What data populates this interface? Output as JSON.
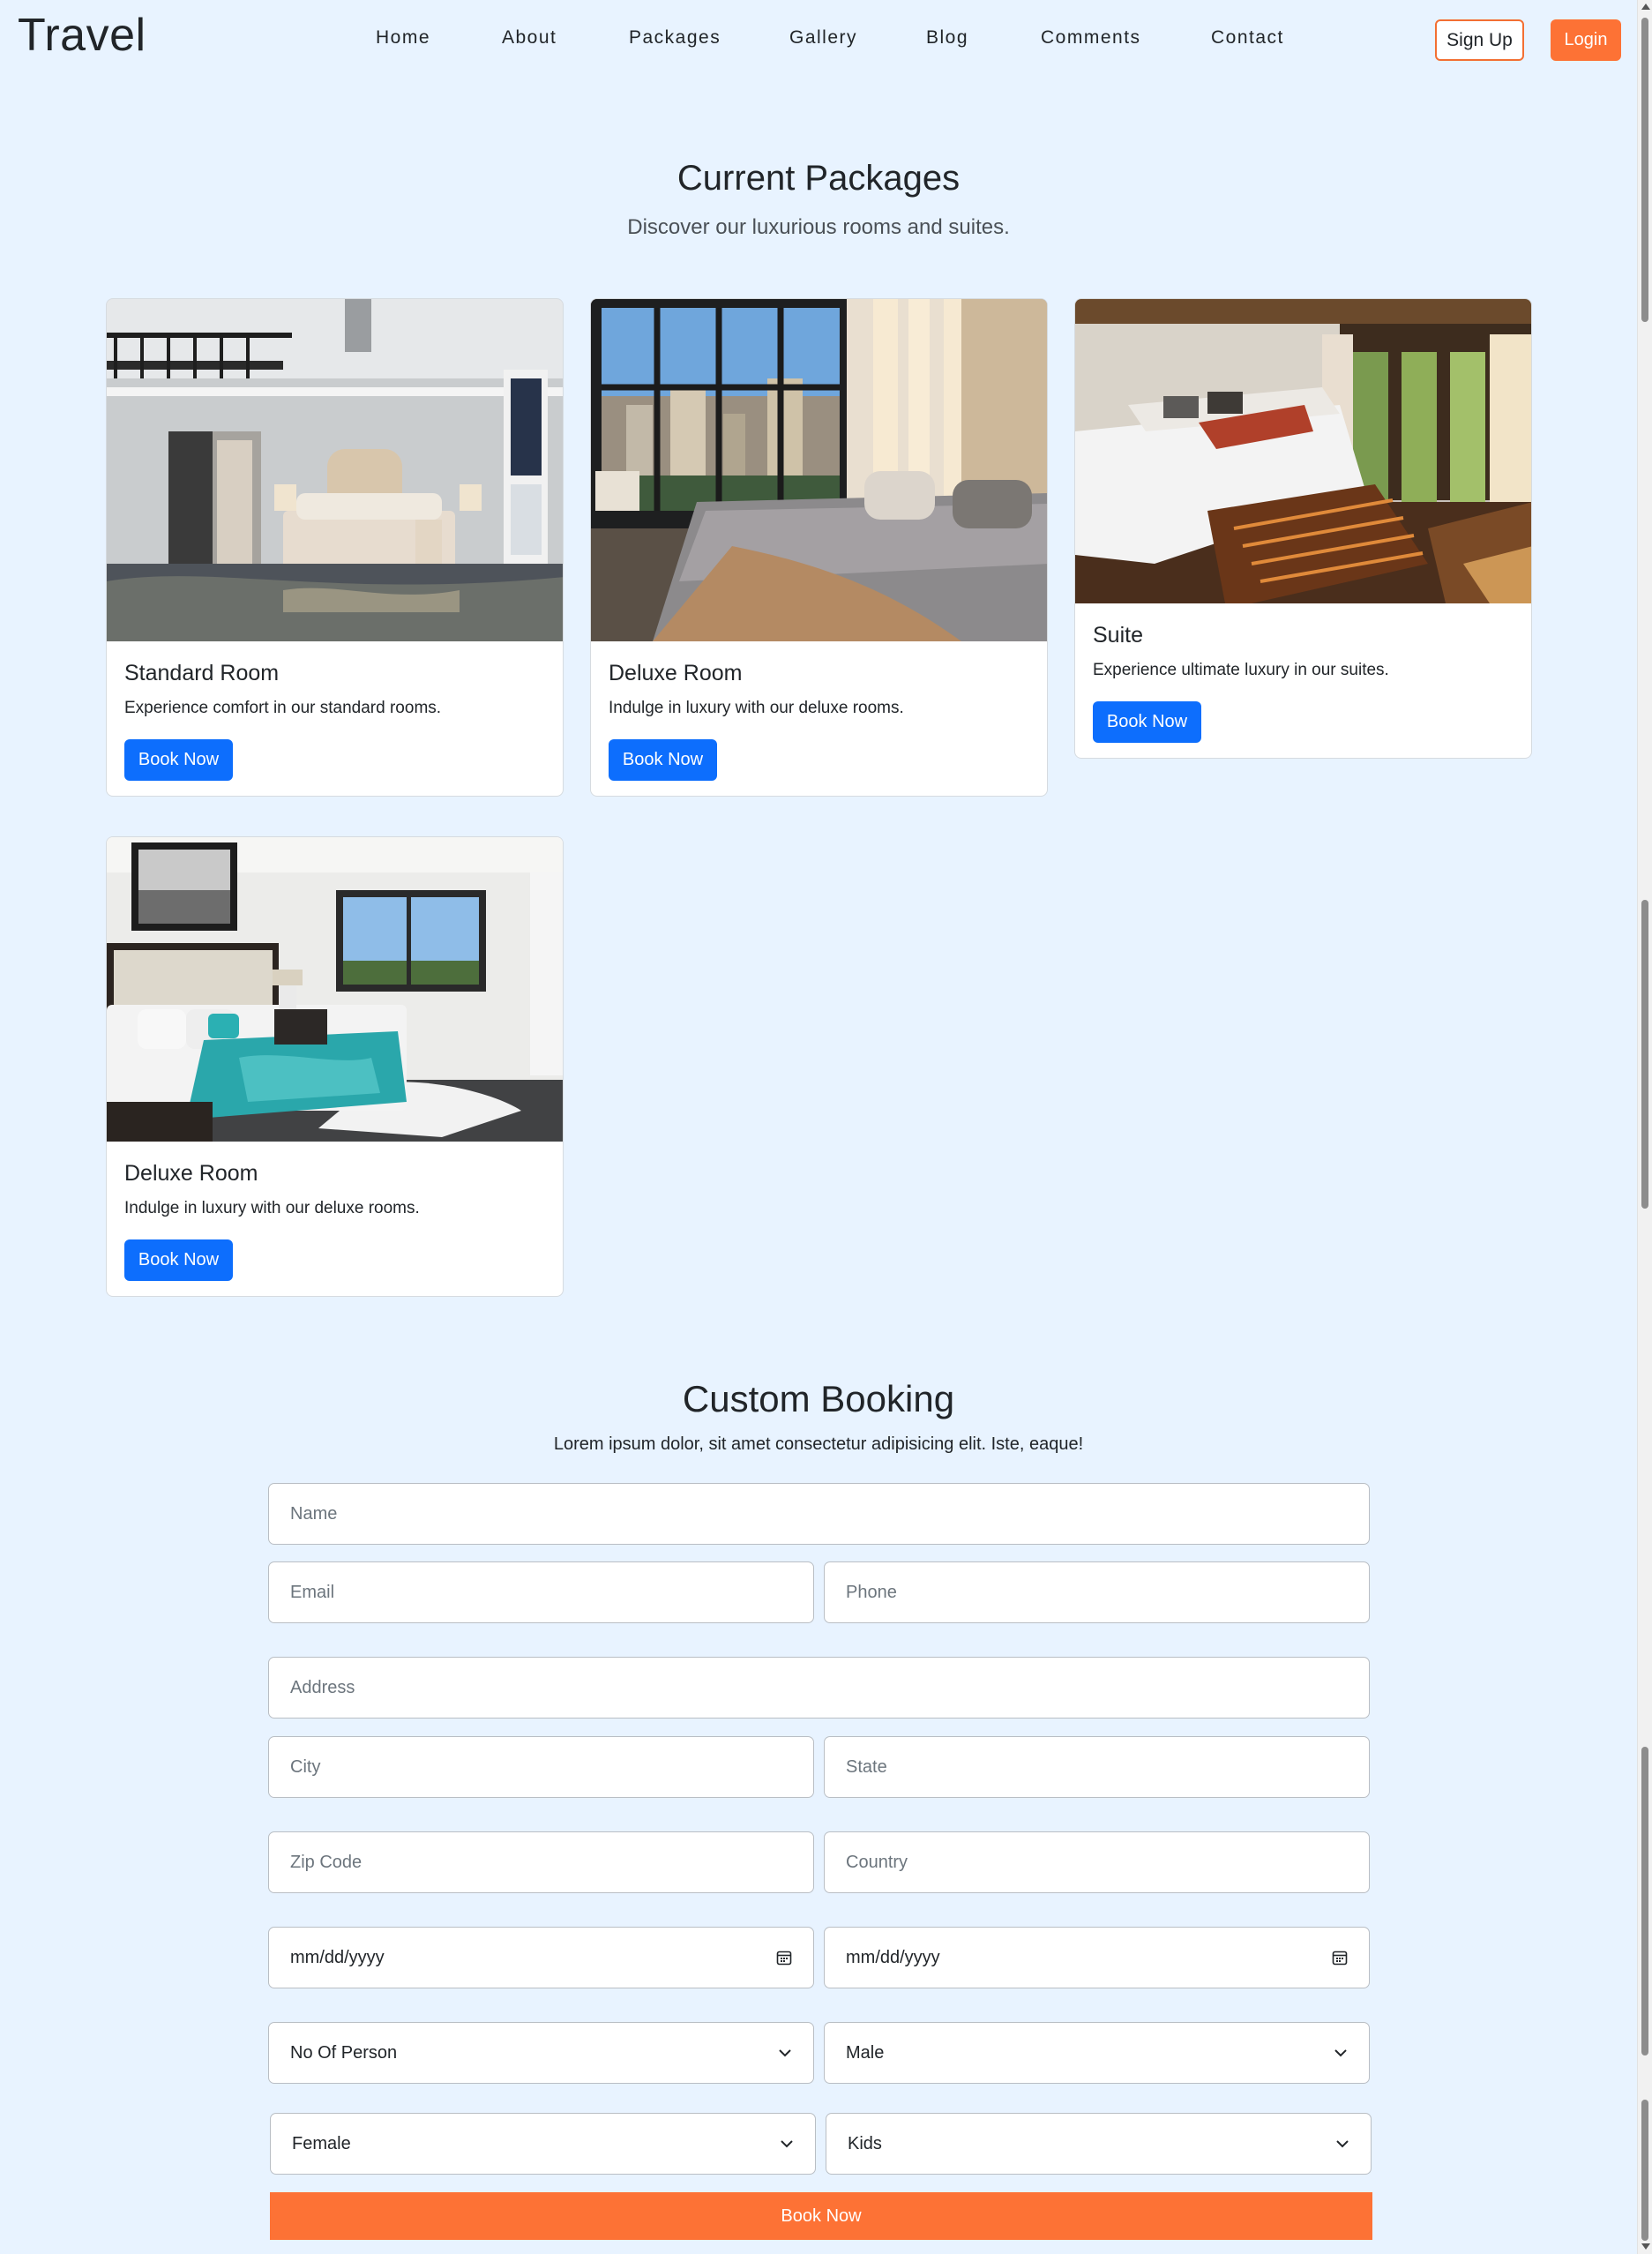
{
  "navbar": {
    "brand": "Travel",
    "links": [
      "Home",
      "About",
      "Packages",
      "Gallery",
      "Blog",
      "Comments",
      "Contact"
    ],
    "signup_label": "Sign Up",
    "login_label": "Login",
    "accent_color": "#fd7235"
  },
  "packages": {
    "title": "Current Packages",
    "subtitle": "Discover our luxurious rooms and suites.",
    "cards": [
      {
        "title": "Standard Room",
        "text": "Experience comfort in our standard rooms.",
        "button": "Book Now"
      },
      {
        "title": "Deluxe Room",
        "text": "Indulge in luxury with our deluxe rooms.",
        "button": "Book Now"
      },
      {
        "title": "Suite",
        "text": "Experience ultimate luxury in our suites.",
        "button": "Book Now"
      },
      {
        "title": "Deluxe Room",
        "text": "Indulge in luxury with our deluxe rooms.",
        "button": "Book Now"
      }
    ],
    "button_color": "#0d6efd"
  },
  "booking": {
    "title": "Custom Booking",
    "subtitle": "Lorem ipsum dolor, sit amet consectetur adipisicing elit. Iste, eaque!",
    "fields": {
      "name": "Name",
      "email": "Email",
      "phone": "Phone",
      "address": "Address",
      "city": "City",
      "state": "State",
      "zip": "Zip Code",
      "country": "Country",
      "date_from": "mm/dd/yyyy",
      "date_to": "mm/dd/yyyy"
    },
    "selects": {
      "persons": "No Of Person",
      "male": "Male",
      "female": "Female",
      "kids": "Kids"
    },
    "submit_label": "Book Now"
  }
}
